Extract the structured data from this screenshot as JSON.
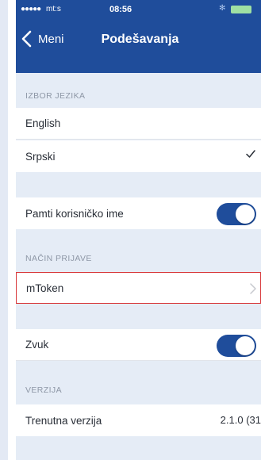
{
  "status_bar": {
    "signal": "●●●●●",
    "carrier": "mt:s",
    "time": "08:56",
    "bluetooth": "✻"
  },
  "nav": {
    "back_label": "Meni",
    "title": "Podešavanja"
  },
  "sections": {
    "language": {
      "header": "IZBOR JEZIKA",
      "options": [
        "English",
        "Srpski"
      ],
      "selected": "Srpski"
    },
    "remember": {
      "label": "Pamti korisničko ime",
      "on": true
    },
    "login": {
      "header": "NAČIN PRIJAVE",
      "method": "mToken"
    },
    "sound": {
      "label": "Zvuk",
      "on": true
    },
    "version": {
      "header": "VERZIJA",
      "label": "Trenutna verzija",
      "value": "2.1.0 (31"
    }
  },
  "colors": {
    "accent": "#1f4d9b",
    "background": "#e5ecf6",
    "highlight_border": "#d8383a"
  }
}
